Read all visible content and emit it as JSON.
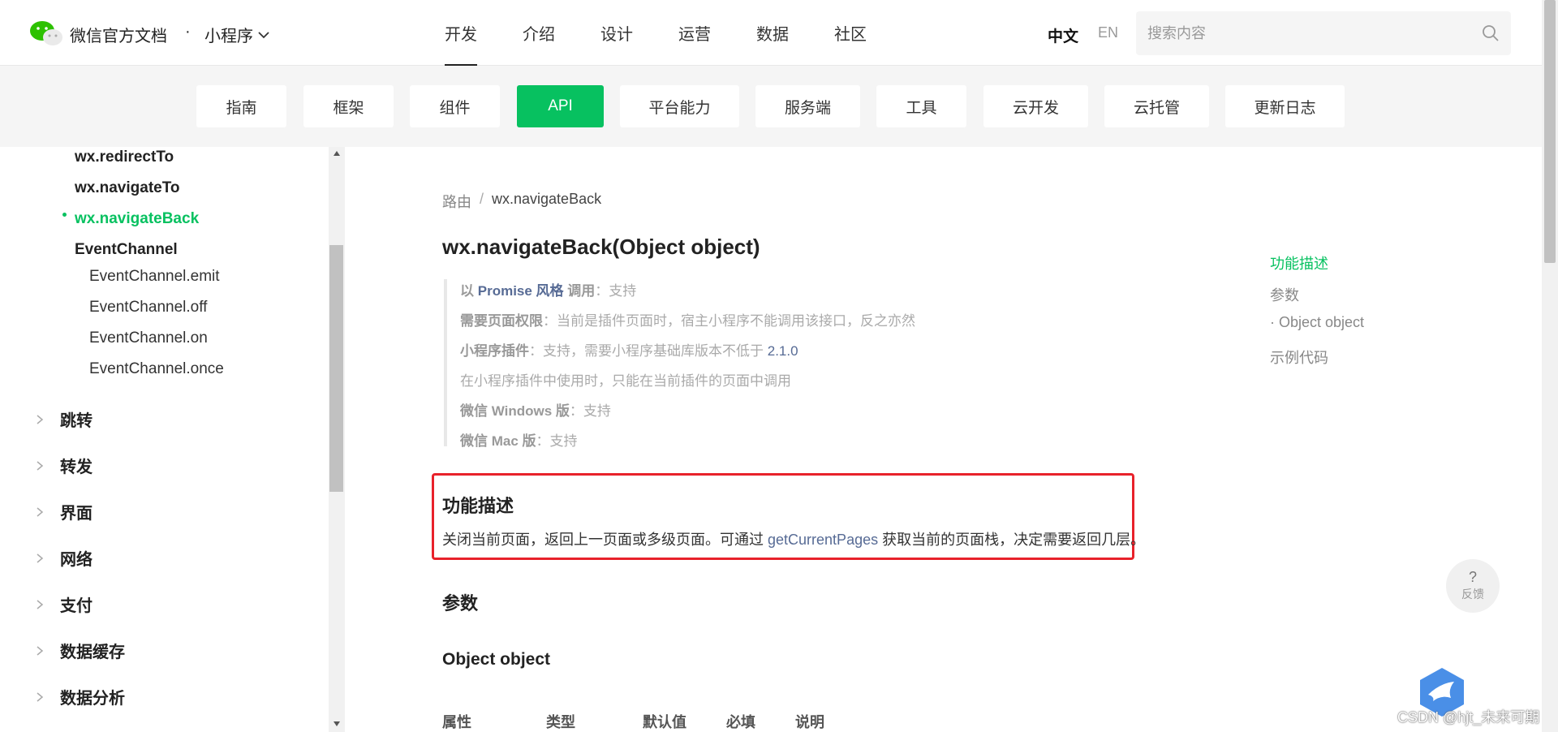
{
  "header": {
    "brand": "微信官方文档",
    "brand_dot": "·",
    "section": "小程序",
    "nav": [
      "开发",
      "介绍",
      "设计",
      "运营",
      "数据",
      "社区"
    ],
    "active_nav": "开发",
    "lang_cn": "中文",
    "lang_en": "EN",
    "search_placeholder": "搜索内容"
  },
  "categories": [
    "指南",
    "框架",
    "组件",
    "API",
    "平台能力",
    "服务端",
    "工具",
    "云开发",
    "云托管",
    "更新日志"
  ],
  "active_category": "API",
  "sidebar": {
    "items": [
      {
        "label": "wx.redirectTo"
      },
      {
        "label": "wx.navigateTo"
      },
      {
        "label": "wx.navigateBack"
      },
      {
        "label": "EventChannel"
      },
      {
        "label": "EventChannel.emit"
      },
      {
        "label": "EventChannel.off"
      },
      {
        "label": "EventChannel.on"
      },
      {
        "label": "EventChannel.once"
      }
    ],
    "groups": [
      "跳转",
      "转发",
      "界面",
      "网络",
      "支付",
      "数据缓存",
      "数据分析"
    ]
  },
  "breadcrumb": {
    "parent": "路由",
    "sep": "/",
    "current": "wx.navigateBack"
  },
  "page_title": "wx.navigateBack(Object object)",
  "support": {
    "l1_pre": "以",
    "l1_hl": "Promise 风格",
    "l1_b": "调用",
    "l1_val": "：支持",
    "l2_b": "需要页面权限",
    "l2_val": "：当前是插件页面时，宿主小程序不能调用该接口，反之亦然",
    "l3_b": "小程序插件",
    "l3_val": "：支持，需要小程序基础库版本不低于",
    "l3_link": "2.1.0",
    "l4": "在小程序插件中使用时，只能在当前插件的页面中调用",
    "l5_b": "微信 Windows 版",
    "l5_val": "：支持",
    "l6_b": "微信 Mac 版",
    "l6_val": "：支持"
  },
  "section_func": {
    "title": "功能描述",
    "desc_pre": "关闭当前页面，返回上一页面或多级页面。可通过",
    "desc_link": "getCurrentPages",
    "desc_post": "获取当前的页面栈，决定需要返回几层。"
  },
  "section_params": {
    "title": "参数",
    "subtitle": "Object object",
    "headers": [
      "属性",
      "类型",
      "默认值",
      "必填",
      "说明"
    ]
  },
  "toc": [
    "功能描述",
    "参数",
    "· Object object",
    "示例代码"
  ],
  "feedback": {
    "q": "?",
    "label": "反馈"
  },
  "watermark": "CSDN @hjt_未来可期",
  "colors": {
    "brand_green": "#07c160",
    "link_blue": "#576b95",
    "highlight_red": "#e8222b"
  }
}
